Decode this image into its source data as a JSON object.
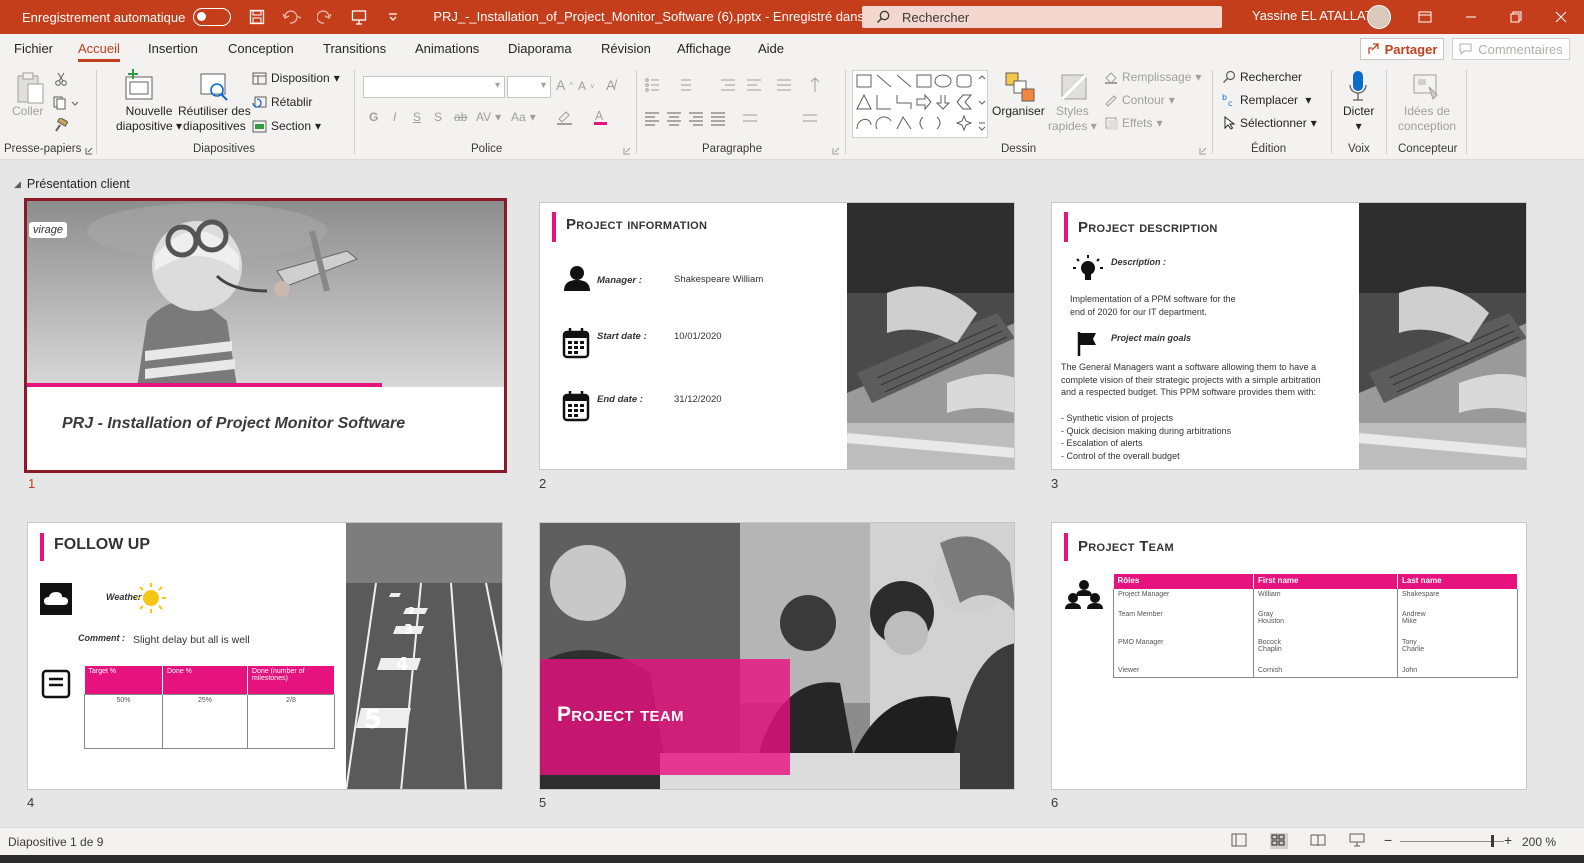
{
  "titlebar": {
    "autosave_label": "Enregistrement automatique",
    "document_title": "PRJ_-_Installation_of_Project_Monitor_Software (6).pptx  -  Enregistré dans ce PC",
    "search_placeholder": "Rechercher",
    "user_name": "Yassine EL ATALLATI",
    "accent_color": "#c43e1c"
  },
  "menu": {
    "tabs": [
      "Fichier",
      "Accueil",
      "Insertion",
      "Conception",
      "Transitions",
      "Animations",
      "Diaporama",
      "Révision",
      "Affichage",
      "Aide"
    ],
    "active_tab": "Accueil",
    "share_label": "Partager",
    "comments_label": "Commentaires"
  },
  "ribbon": {
    "clipboard": {
      "paste": "Coller",
      "label": "Presse-papiers"
    },
    "slides": {
      "new_slide": "Nouvelle",
      "new_slide_2": "diapositive",
      "reuse": "Réutiliser des",
      "reuse_2": "diapositives",
      "layout": "Disposition",
      "reset": "Rétablir",
      "section": "Section",
      "label": "Diapositives"
    },
    "font": {
      "label": "Police",
      "bold": "G",
      "italic": "I",
      "underline": "S",
      "shadow": "S",
      "strike": "ab",
      "spacing": "AV",
      "case": "Aa"
    },
    "paragraph": {
      "label": "Paragraphe"
    },
    "drawing": {
      "arrange": "Organiser",
      "styles": "Styles",
      "styles_2": "rapides",
      "fill": "Remplissage",
      "outline": "Contour",
      "effects": "Effets",
      "label": "Dessin"
    },
    "editing": {
      "find": "Rechercher",
      "replace": "Remplacer",
      "select": "Sélectionner",
      "label": "Édition"
    },
    "voice": {
      "dictate": "Dicter",
      "label": "Voix"
    },
    "designer": {
      "ideas": "Idées de",
      "ideas_2": "conception",
      "label": "Concepteur"
    }
  },
  "section_name": "Présentation client",
  "slides": {
    "s1": {
      "number": "1",
      "logo": "virage",
      "title": "PRJ - Installation of Project Monitor Software"
    },
    "s2": {
      "number": "2",
      "title": "Project information",
      "manager_label": "Manager :",
      "manager_value": "Shakespeare William",
      "start_label": "Start date :",
      "start_value": "10/01/2020",
      "end_label": "End date :",
      "end_value": "31/12/2020"
    },
    "s3": {
      "number": "3",
      "title": "Project description",
      "desc_label": "Description :",
      "desc_line1": "Implementation of a PPM software for the",
      "desc_line2": "end of 2020 for our IT department.",
      "goals_label": "Project main goals",
      "goals_p1": "The General Managers want a software allowing them to have a",
      "goals_p2": "complete vision of their strategic projects with a simple arbitration",
      "goals_p3": "and a respected budget. This PPM software provides them with:",
      "bullet1": "- Synthetic vision of projects",
      "bullet2": "- Quick decision making during arbitrations",
      "bullet3": "- Escalation of alerts",
      "bullet4": "- Control of the overall budget"
    },
    "s4": {
      "number": "4",
      "title": "FOLLOW UP",
      "weather_label": "Weather :",
      "comment_label": "Comment :",
      "comment_value": "Slight delay but all is well",
      "table_headers": [
        "Target %",
        "Done %",
        "Done (number of milestones)"
      ],
      "table_values": [
        "50%",
        "25%",
        "2/8"
      ]
    },
    "s5": {
      "number": "5",
      "title": "Project team"
    },
    "s6": {
      "number": "6",
      "title": "Project Team",
      "headers": [
        "Rôles",
        "First name",
        "Last name"
      ],
      "rows": [
        {
          "role": "Project Manager",
          "first": "William",
          "last": "Shakespare"
        },
        {
          "role": "Team Member",
          "first": "Gray\nHouston",
          "last": "Andrew\nMike"
        },
        {
          "role": "PMO Manager",
          "first": "Bocock\nChaplin",
          "last": "Tony\nCharlie"
        },
        {
          "role": "Viewer",
          "first": "Cornish",
          "last": "John"
        }
      ]
    }
  },
  "statusbar": {
    "slide_info": "Diapositive 1 de 9",
    "zoom": "200 %"
  },
  "colors": {
    "accent_pink": "#e6127e",
    "selection": "#8a1a2a"
  }
}
